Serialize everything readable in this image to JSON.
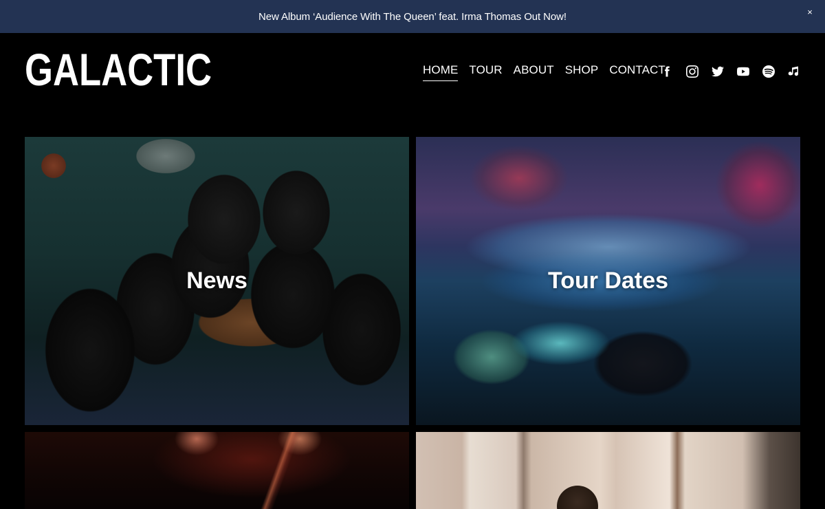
{
  "announcement": {
    "text": "New Album ‘Audience With The Queen’ feat. Irma Thomas Out Now!",
    "close_label": "×"
  },
  "header": {
    "logo_text": "GALACTIC",
    "nav": [
      {
        "label": "HOME",
        "active": true
      },
      {
        "label": "TOUR",
        "active": false
      },
      {
        "label": "ABOUT",
        "active": false
      },
      {
        "label": "SHOP",
        "active": false
      },
      {
        "label": "CONTACT",
        "active": false
      }
    ],
    "social_icons": [
      "facebook-icon",
      "instagram-icon",
      "twitter-icon",
      "youtube-icon",
      "spotify-icon",
      "music-note-icon"
    ]
  },
  "tiles": [
    {
      "label": "News"
    },
    {
      "label": "Tour Dates"
    },
    {
      "label": ""
    },
    {
      "label": ""
    }
  ],
  "colors": {
    "announcement_bg": "#233353",
    "page_bg": "#000000",
    "text": "#ffffff"
  }
}
